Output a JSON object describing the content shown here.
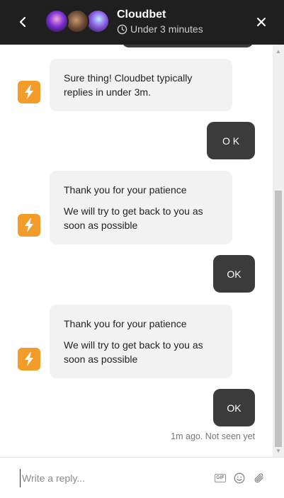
{
  "header": {
    "title": "Cloudbet",
    "subtitle": "Under 3 minutes"
  },
  "messages": [
    {
      "from": "bot",
      "lines": [
        "Sure thing! Cloudbet typically replies in under 3m."
      ]
    },
    {
      "from": "user",
      "text": "O K"
    },
    {
      "from": "bot",
      "lines": [
        "Thank you for your patience",
        "We will try to get back to you as soon as possible"
      ]
    },
    {
      "from": "user",
      "text": "OK"
    },
    {
      "from": "bot",
      "lines": [
        "Thank you for your patience",
        "We will try to get back to you as soon as possible"
      ]
    },
    {
      "from": "user",
      "text": "OK"
    }
  ],
  "seen_status": "1m ago. Not seen yet",
  "composer": {
    "placeholder": "Write a reply...",
    "gif_label": "GIF"
  },
  "colors": {
    "header_bg": "#1f1f1f",
    "user_bubble": "#3b3b3b",
    "bot_bubble": "#f2f2f2",
    "bot_icon": "#f39c2a"
  },
  "icons": [
    "chevron-left-icon",
    "clock-icon",
    "close-icon",
    "lightning-icon",
    "gif-icon",
    "emoji-icon",
    "paperclip-icon"
  ]
}
